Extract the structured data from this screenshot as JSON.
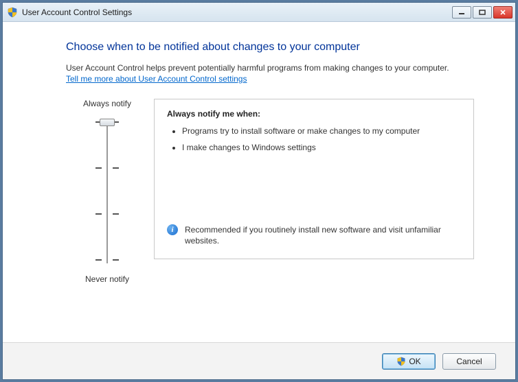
{
  "window": {
    "title": "User Account Control Settings"
  },
  "heading": "Choose when to be notified about changes to your computer",
  "description": "User Account Control helps prevent potentially harmful programs from making changes to your computer.",
  "link": "Tell me more about User Account Control settings",
  "slider": {
    "labelTop": "Always notify",
    "labelBottom": "Never notify",
    "level": 3,
    "levels": 4
  },
  "info": {
    "title": "Always notify me when:",
    "bullets": [
      "Programs try to install software or make changes to my computer",
      "I make changes to Windows settings"
    ],
    "recommendation": "Recommended if you routinely install new software and visit unfamiliar websites."
  },
  "buttons": {
    "ok": "OK",
    "cancel": "Cancel"
  }
}
